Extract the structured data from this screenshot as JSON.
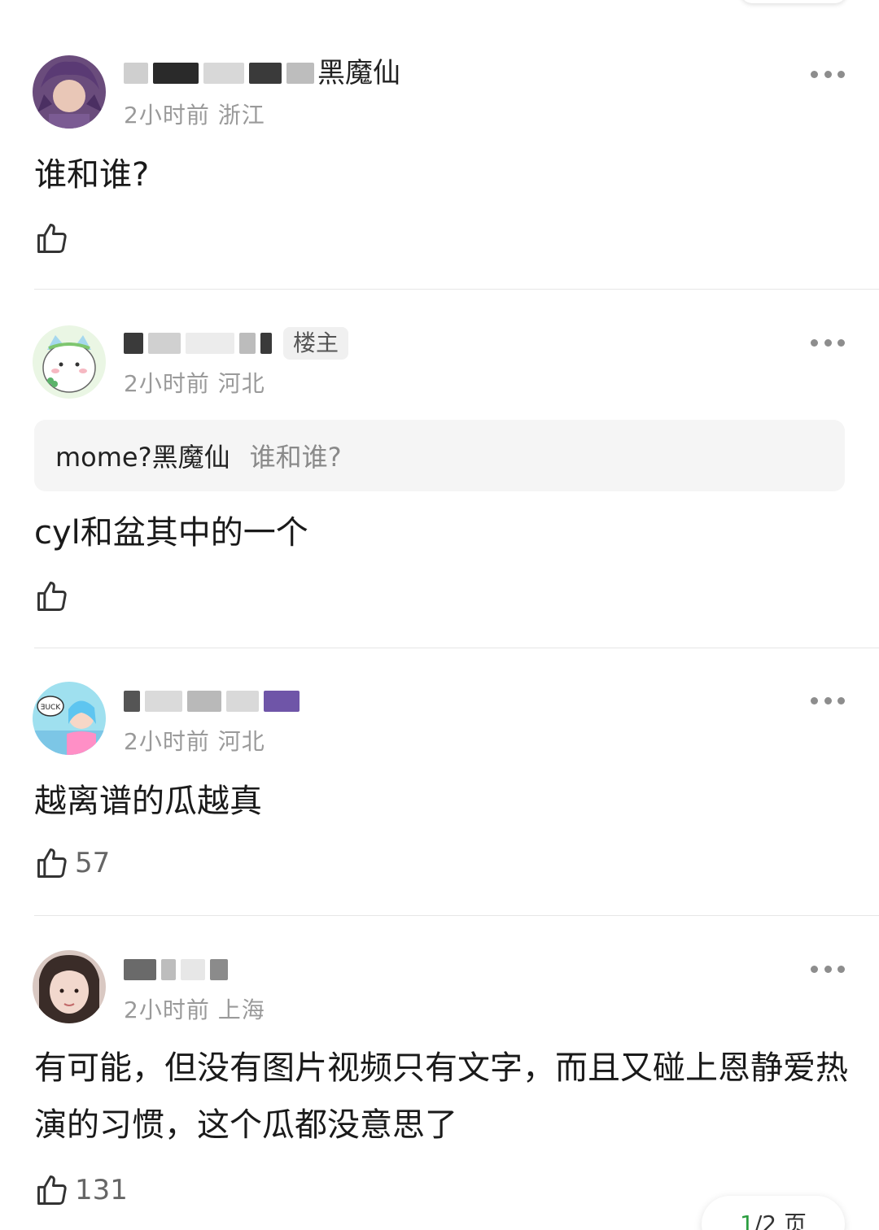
{
  "comments": [
    {
      "name_visible": "黑魔仙",
      "time": "2小时前",
      "location": "浙江",
      "text": "谁和谁?",
      "likes": ""
    },
    {
      "name_visible": "",
      "badge": "楼主",
      "time": "2小时前",
      "location": "河北",
      "quote": {
        "name": "mome?黑魔仙",
        "text": "谁和谁?"
      },
      "text": "cyl和盆其中的一个",
      "likes": ""
    },
    {
      "name_visible": "",
      "time": "2小时前",
      "location": "河北",
      "text": "越离谱的瓜越真",
      "likes": "57"
    },
    {
      "name_visible": "",
      "time": "2小时前",
      "location": "上海",
      "text": "有可能，但没有图片视频只有文字，而且又碰上恩静爱热演的习惯，这个瓜都没意思了",
      "likes": "131"
    }
  ],
  "pager": {
    "current": "1",
    "rest": "/2 页"
  },
  "icons": {
    "like": "thumbs-up-icon",
    "more": "more-dots-icon"
  },
  "colors": {
    "divider": "#e6e6e6",
    "meta": "#9a9a9a",
    "quote_bg": "#f5f5f5",
    "pager_current": "#2a9d3f"
  }
}
